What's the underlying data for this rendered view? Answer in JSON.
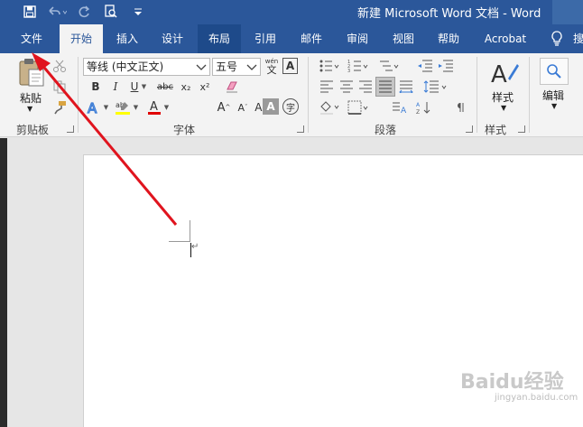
{
  "window": {
    "title": "新建 Microsoft Word 文档  -  Word",
    "qat_icons": [
      "save-icon",
      "undo-icon",
      "redo-icon",
      "print-preview-icon",
      "customize-qat-icon"
    ]
  },
  "tabs": [
    {
      "label": "文件"
    },
    {
      "label": "开始"
    },
    {
      "label": "插入"
    },
    {
      "label": "设计"
    },
    {
      "label": "布局"
    },
    {
      "label": "引用"
    },
    {
      "label": "邮件"
    },
    {
      "label": "审阅"
    },
    {
      "label": "视图"
    },
    {
      "label": "帮助"
    },
    {
      "label": "Acrobat"
    },
    {
      "label": "搜"
    }
  ],
  "active_tab": "开始",
  "ribbon": {
    "clipboard": {
      "label": "剪贴板",
      "paste": "粘贴"
    },
    "font": {
      "label": "字体",
      "font_name": "等线 (中文正文)",
      "font_size": "五号",
      "bold": "B",
      "italic": "I",
      "underline": "U",
      "strike": "abc",
      "subscript": "x₂",
      "superscript": "x²",
      "grow": "A",
      "shrink": "A",
      "case": "Aa",
      "wen": "文",
      "wen_small": "wén",
      "zi": "字"
    },
    "paragraph": {
      "label": "段落"
    },
    "styles": {
      "label": "样式",
      "button": "样式"
    },
    "editing": {
      "button": "编辑"
    }
  },
  "watermark": {
    "logo": "Baidu经验",
    "url": "jingyan.baidu.com"
  },
  "colors": {
    "brand": "#2b579a",
    "ribbon": "#f3f3f3",
    "arrow": "#e0141e",
    "highlight": "#ffff00",
    "font_red": "#e00000"
  }
}
